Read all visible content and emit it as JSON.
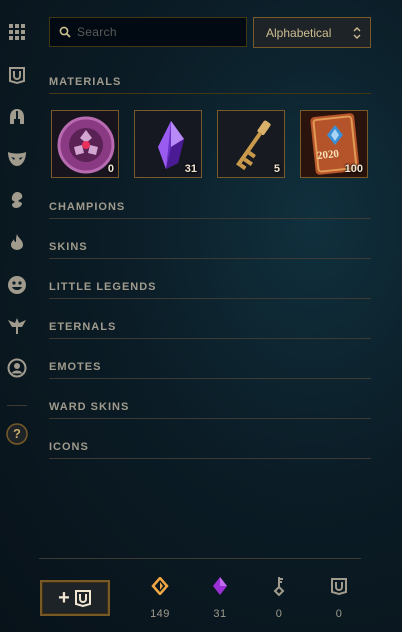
{
  "sidebar": {
    "items": [
      {
        "icon": "grid-icon"
      },
      {
        "icon": "chest-icon"
      },
      {
        "icon": "helmet-icon"
      },
      {
        "icon": "mask-icon"
      },
      {
        "icon": "little-legend-icon"
      },
      {
        "icon": "flame-icon"
      },
      {
        "icon": "emote-icon"
      },
      {
        "icon": "ward-icon"
      },
      {
        "icon": "profile-icon"
      }
    ],
    "help_label": "?"
  },
  "search": {
    "placeholder": "Search",
    "value": ""
  },
  "sort": {
    "selected": "Alphabetical"
  },
  "sections": {
    "materials": "MATERIALS",
    "champions": "CHAMPIONS",
    "skins": "SKINS",
    "little_legends": "LITTLE LEGENDS",
    "eternals": "ETERNALS",
    "emotes": "EMOTES",
    "ward_skins": "WARD SKINS",
    "icons": "ICONS"
  },
  "materials": [
    {
      "name": "Mythic Token",
      "count": "0",
      "icon": "token-icon"
    },
    {
      "name": "Gemstone",
      "count": "31",
      "icon": "gem-icon"
    },
    {
      "name": "Hextech Key",
      "count": "5",
      "icon": "key-icon"
    },
    {
      "name": "2020 Event Token",
      "count": "100",
      "icon": "event-token-icon",
      "year": "2020"
    }
  ],
  "footer": {
    "currencies": [
      {
        "name": "Blue Essence",
        "value": "149",
        "color": "#f0a843"
      },
      {
        "name": "Gemstones",
        "value": "31",
        "color": "#9b2fd6"
      },
      {
        "name": "Key Fragments",
        "value": "0",
        "color": "#a09b8c"
      },
      {
        "name": "Chests",
        "value": "0",
        "color": "#a09b8c"
      }
    ]
  },
  "colors": {
    "gold": "#785a28",
    "gold_light": "#c8aa6e",
    "text": "#a09b8c",
    "bg": "#0b1c26"
  }
}
